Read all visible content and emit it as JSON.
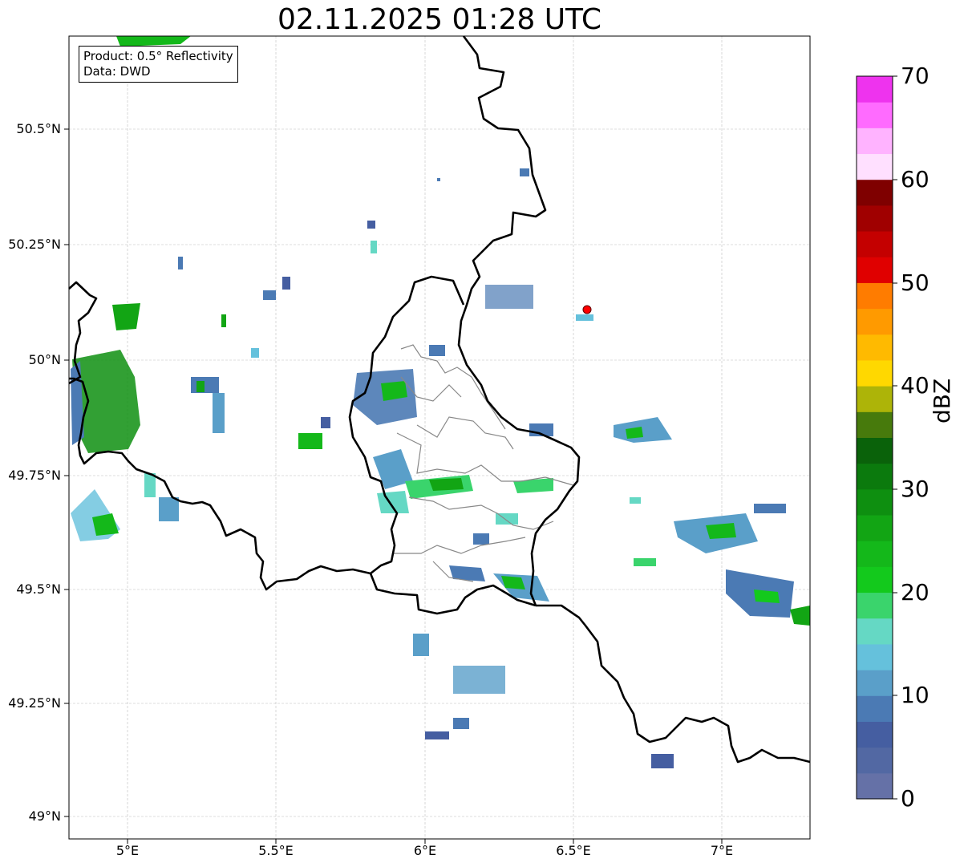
{
  "title": "02.11.2025 01:28 UTC",
  "info": {
    "product": "Product: 0.5° Reflectivity",
    "source": "Data: DWD"
  },
  "map": {
    "lon_range": [
      4.8,
      7.3
    ],
    "lat_range": [
      48.95,
      50.7
    ],
    "lat_ticks": [
      "50.5°N",
      "50.25°N",
      "50°N",
      "49.75°N",
      "49.5°N",
      "49.25°N",
      "49°N"
    ],
    "lon_ticks": [
      "5°E",
      "5.5°E",
      "6°E",
      "6.5°E",
      "7°E"
    ],
    "marker": {
      "lon": 6.55,
      "lat": 50.11,
      "color": "#ff0000"
    }
  },
  "colorbar": {
    "label": "dBZ",
    "ticks": [
      "0",
      "10",
      "20",
      "30",
      "40",
      "50",
      "60",
      "70"
    ],
    "colors": [
      "#6571a7",
      "#5268a3",
      "#455ea1",
      "#4b7ab4",
      "#5a9fc9",
      "#65c1dc",
      "#65d8c4",
      "#3ad46c",
      "#13c91c",
      "#14b81a",
      "#12a514",
      "#0e8f10",
      "#0b7a0d",
      "#0a620a",
      "#477a0c",
      "#adb408",
      "#ffd800",
      "#ffba00",
      "#ff9a00",
      "#ff7c00",
      "#e00000",
      "#c40000",
      "#a00000",
      "#7f0000",
      "#ffe0ff",
      "#ffb3ff",
      "#ff6bff",
      "#ee33ee"
    ]
  }
}
